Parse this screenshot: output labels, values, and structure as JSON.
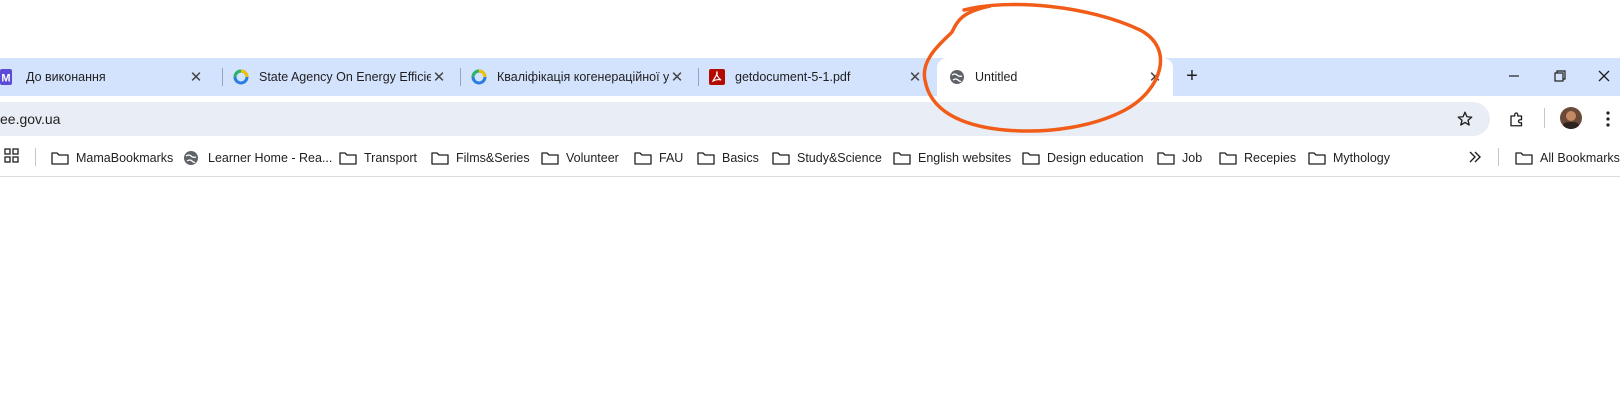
{
  "tabs": [
    {
      "title": "До виконання",
      "favicon": "m-app-icon"
    },
    {
      "title": "State Agency On Energy Efficien",
      "favicon": "saee-logo-icon"
    },
    {
      "title": "Кваліфікація когенераційної у",
      "favicon": "saee-logo-icon"
    },
    {
      "title": "getdocument-5-1.pdf",
      "favicon": "pdf-icon"
    },
    {
      "title": "Untitled",
      "favicon": "globe-icon",
      "active": true
    }
  ],
  "new_tab_label": "+",
  "omnibox": {
    "url": "ee.gov.ua"
  },
  "bookmarks": [
    {
      "label": "MamaBookmarks",
      "icon": "folder-icon"
    },
    {
      "label": "Learner Home - Rea...",
      "icon": "globe-icon"
    },
    {
      "label": "Transport",
      "icon": "folder-icon"
    },
    {
      "label": "Films&Series",
      "icon": "folder-icon"
    },
    {
      "label": "Volunteer",
      "icon": "folder-icon"
    },
    {
      "label": "FAU",
      "icon": "folder-icon"
    },
    {
      "label": "Basics",
      "icon": "folder-icon"
    },
    {
      "label": "Study&Science",
      "icon": "folder-icon"
    },
    {
      "label": "English websites",
      "icon": "folder-icon"
    },
    {
      "label": "Design education",
      "icon": "folder-icon"
    },
    {
      "label": "Job",
      "icon": "folder-icon"
    },
    {
      "label": "Recepies",
      "icon": "folder-icon"
    },
    {
      "label": "Mythology",
      "icon": "folder-icon"
    }
  ],
  "all_bookmarks_label": "All Bookmarks",
  "colors": {
    "tabstrip": "#d3e3fd",
    "omnibox": "#e9eef6",
    "annotation": "#f25c19",
    "pdf": "#b30b00"
  }
}
